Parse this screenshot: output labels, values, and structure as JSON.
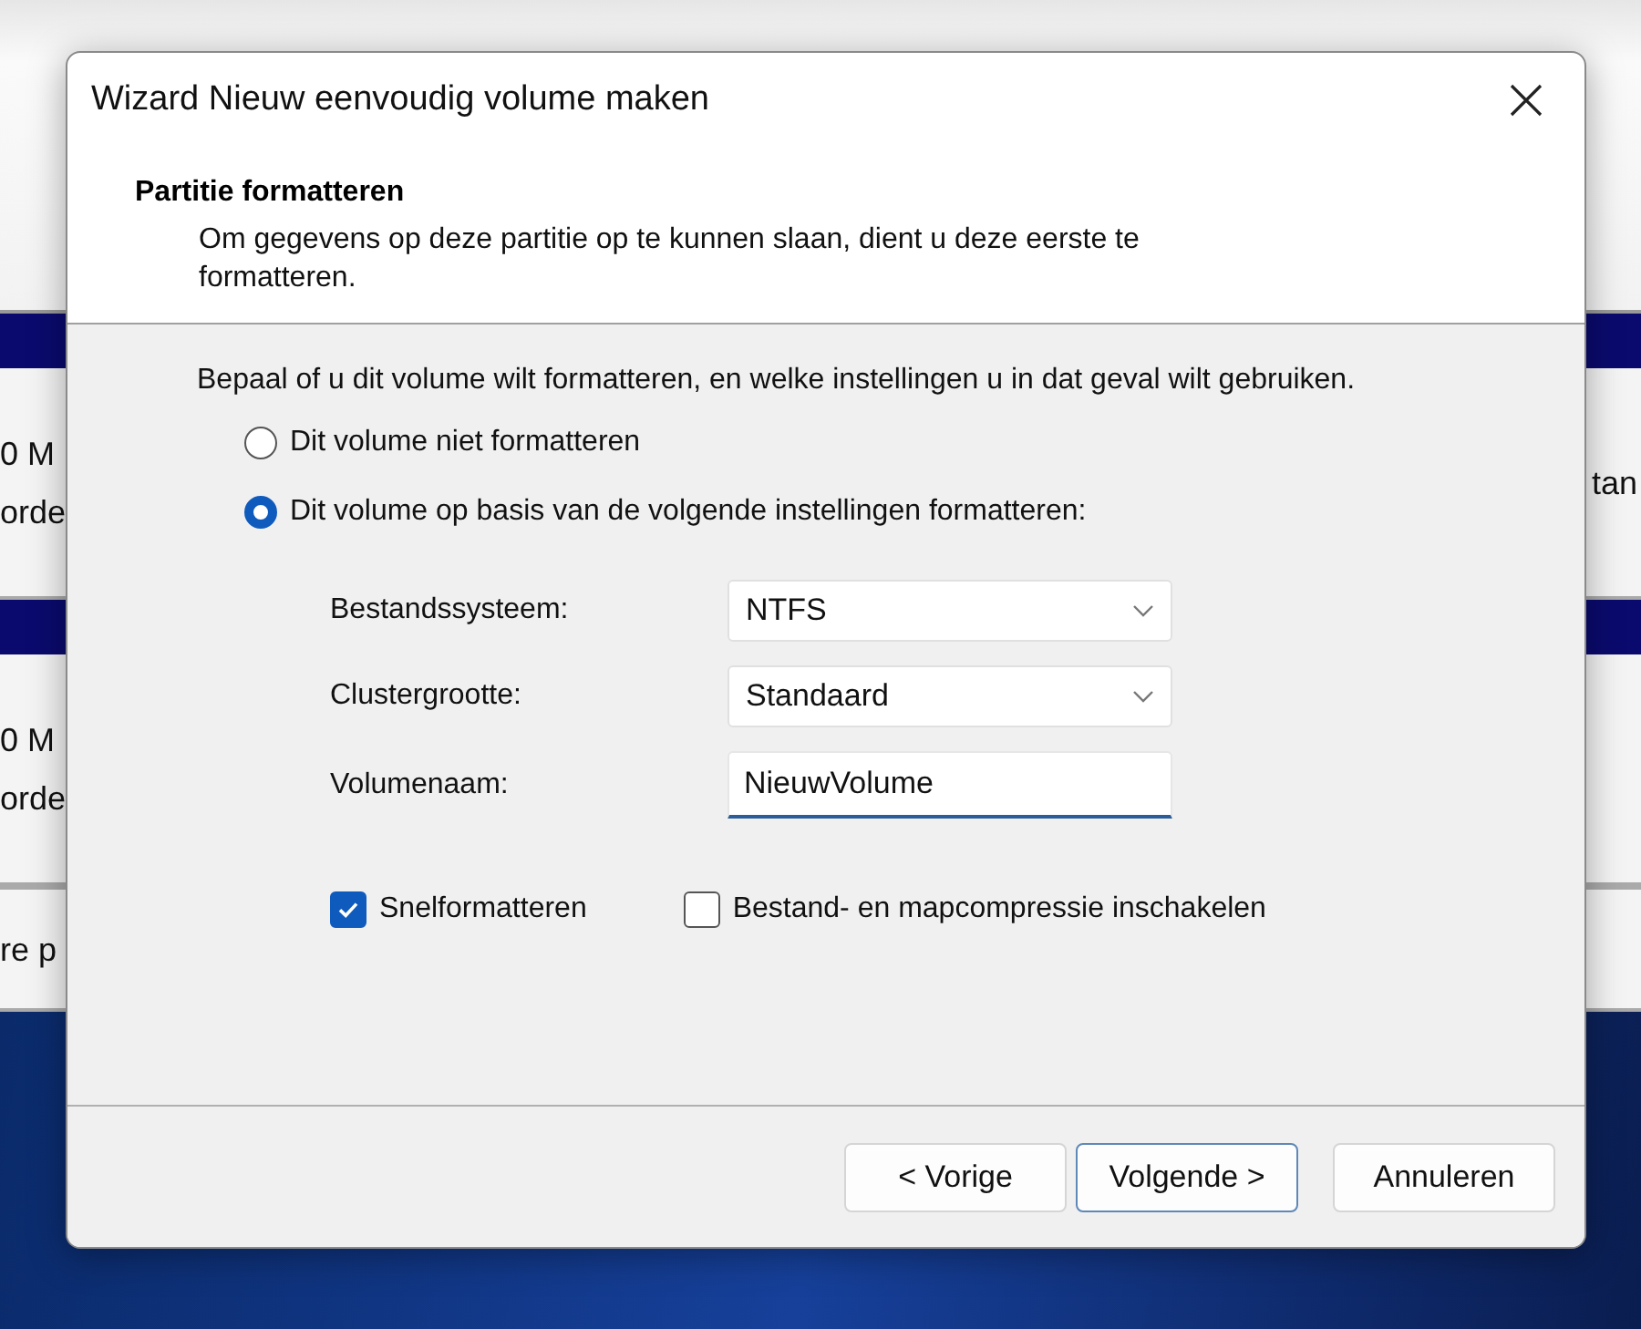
{
  "background": {
    "panels": [
      {
        "left_lines": [
          "0 M",
          "orde"
        ],
        "right_line": "tan"
      },
      {
        "left_lines": [
          "0 M",
          "orde"
        ]
      },
      {
        "left_lines": [
          "re p"
        ]
      }
    ]
  },
  "window": {
    "title": "Wizard Nieuw eenvoudig volume maken"
  },
  "header": {
    "title": "Partitie formatteren",
    "subtitle": "Om gegevens op deze partitie op te kunnen slaan, dient u deze eerste te formatteren."
  },
  "body": {
    "instruction": "Bepaal of u dit volume wilt formatteren, en welke instellingen u in dat geval wilt gebruiken.",
    "options": [
      {
        "label": "Dit volume niet formatteren",
        "selected": false
      },
      {
        "label": "Dit volume op basis van de volgende instellingen formatteren:",
        "selected": true
      }
    ],
    "fields": [
      {
        "label": "Bestandssysteem:",
        "kind": "dropdown",
        "value": "NTFS"
      },
      {
        "label": "Clustergrootte:",
        "kind": "dropdown",
        "value": "Standaard"
      },
      {
        "label": "Volumenaam:",
        "kind": "text",
        "value": "NieuwVolume"
      }
    ],
    "checkboxes": [
      {
        "label": "Snelformatteren",
        "checked": true
      },
      {
        "label": "Bestand- en mapcompressie inschakelen",
        "checked": false
      }
    ]
  },
  "buttons": [
    {
      "label": "< Vorige",
      "default": false
    },
    {
      "label": "Volgende >",
      "default": true
    },
    {
      "label": "Annuleren",
      "default": false
    }
  ]
}
